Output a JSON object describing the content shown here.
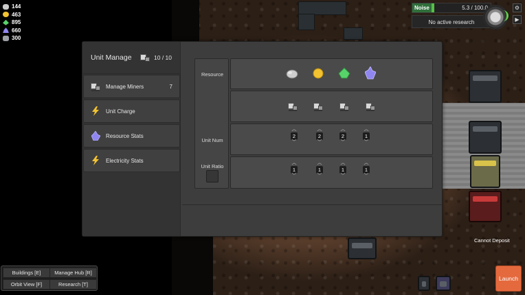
{
  "resources": [
    {
      "name": "stone",
      "amount": "144",
      "color": "#c9c9c9"
    },
    {
      "name": "gold",
      "amount": "463",
      "color": "#f2c230"
    },
    {
      "name": "emerald",
      "amount": "895",
      "color": "#57d36a"
    },
    {
      "name": "crystal",
      "amount": "660",
      "color": "#8f86f0"
    },
    {
      "name": "iron",
      "amount": "300",
      "color": "#9aa0a6"
    }
  ],
  "hud": {
    "noise_label": "Noise",
    "noise_value": "5.3 / 100.0",
    "research_status": "No active research"
  },
  "modal": {
    "title": "Unit Manage",
    "unit_count": "10 / 10",
    "sidebar_items": [
      {
        "label": "Manage Miners",
        "count": "7",
        "icon": "miner-icon"
      },
      {
        "label": "Unit Charge",
        "icon": "lightning-icon"
      },
      {
        "label": "Resource Stats",
        "icon": "crystal-icon"
      },
      {
        "label": "Electricity Stats",
        "icon": "lightning-icon"
      }
    ],
    "labels": {
      "resource": "Resource",
      "unit_num": "Unit Num",
      "unit_ratio": "Unit Ratio"
    },
    "columns": [
      {
        "resource": "stone",
        "unit_num": "2",
        "unit_ratio": "1"
      },
      {
        "resource": "gold",
        "unit_num": "2",
        "unit_ratio": "1"
      },
      {
        "resource": "emerald",
        "unit_num": "2",
        "unit_ratio": "1"
      },
      {
        "resource": "crystal",
        "unit_num": "1",
        "unit_ratio": "1"
      }
    ]
  },
  "bottom_buttons": {
    "buildings": "Buildings [E]",
    "manage_hub": "Manage Hub [R]",
    "orbit_view": "Orbit View [F]",
    "research": "Research [T]"
  },
  "status": {
    "deposit": "Cannot Deposit"
  },
  "launch_label": "Launch",
  "colors": {
    "accent_launch": "#e46a3e",
    "noise_green": "#58c048",
    "lightning": "#f2c230"
  }
}
